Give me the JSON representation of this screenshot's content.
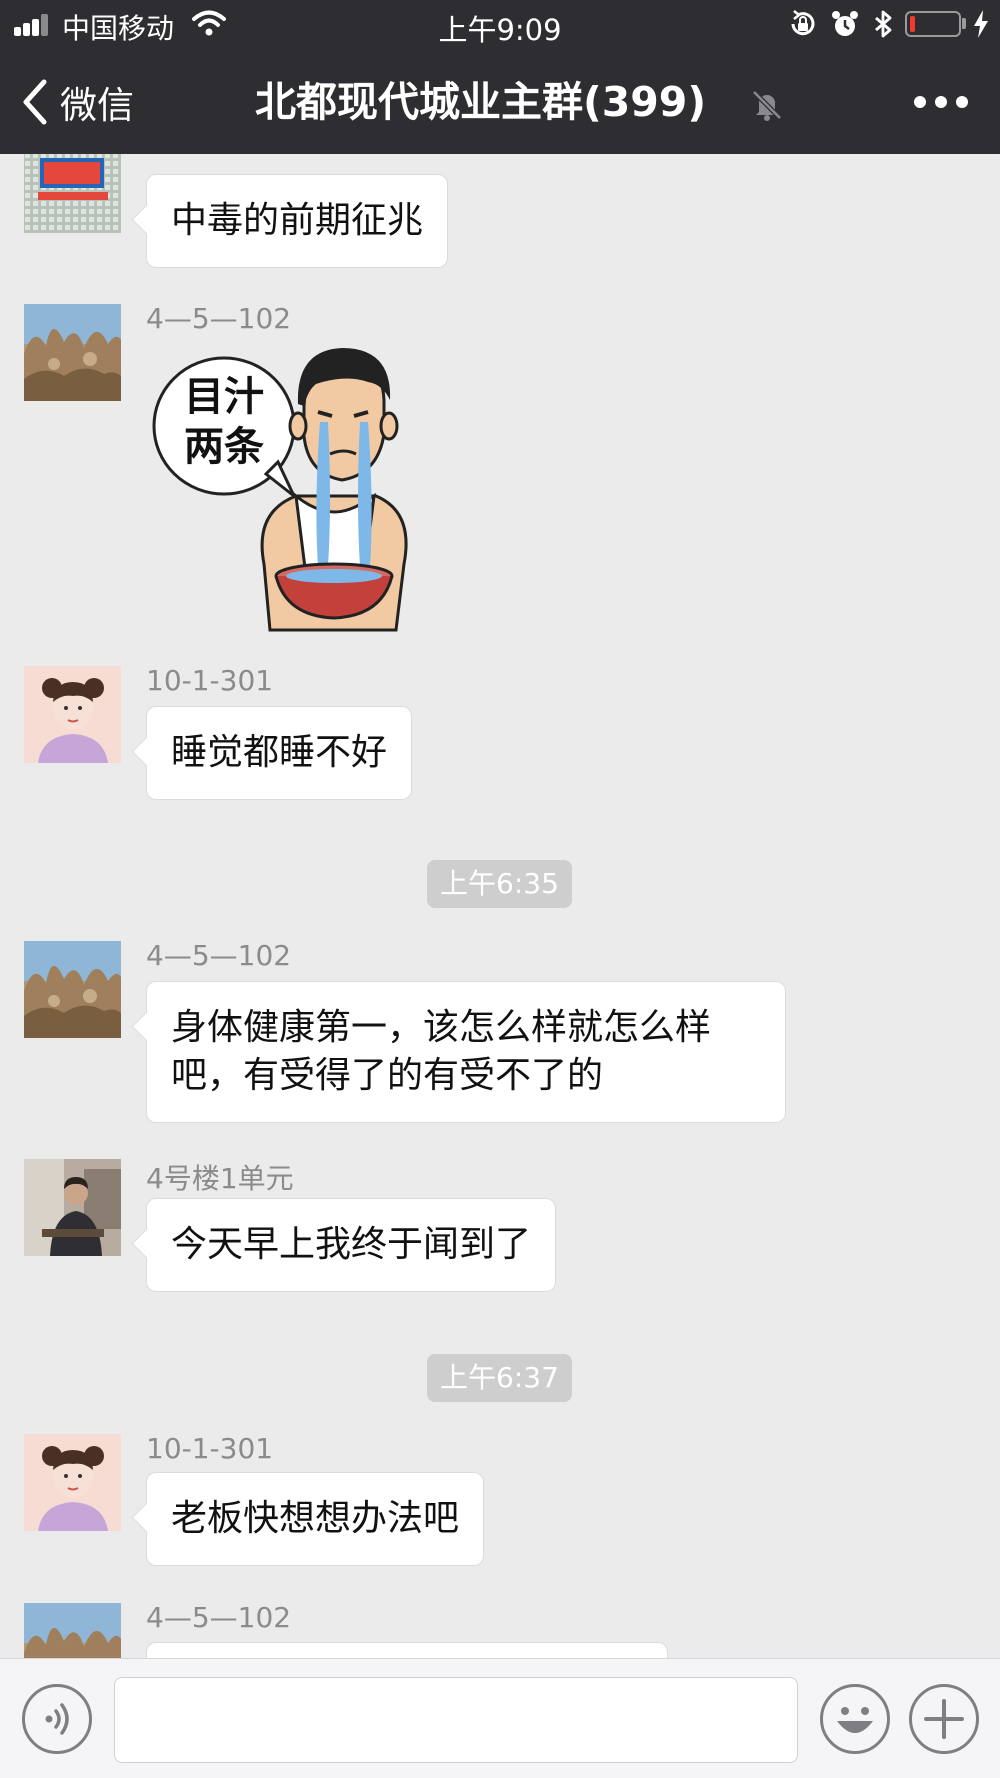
{
  "status_bar": {
    "carrier": "中国移动",
    "time": "上午9:09",
    "icons": [
      "signal-icon",
      "wifi-icon",
      "orientation-lock-icon",
      "alarm-icon",
      "bluetooth-icon",
      "battery-icon",
      "charging-icon"
    ],
    "battery_level": 0.08,
    "battery_color": "#f23b2f"
  },
  "nav": {
    "back_label": "微信",
    "title": "北都现代城业主群(399)",
    "muted": true,
    "more_icon": "more-icon"
  },
  "messages": [
    {
      "type": "text",
      "sender": "",
      "text": "中毒的前期征兆",
      "avatar": "avatar-building"
    },
    {
      "type": "sticker",
      "sender": "4—5—102",
      "sticker_text": "目汁两条",
      "sticker_line1": "目汁",
      "sticker_line2": "两条",
      "avatar": "avatar-rocks"
    },
    {
      "type": "text",
      "sender": "10-1-301",
      "text": "睡觉都睡不好",
      "avatar": "avatar-girl"
    },
    {
      "type": "time",
      "text": "上午6:35"
    },
    {
      "type": "text",
      "sender": "4—5—102",
      "text": "身体健康第一，该怎么样就怎么样吧，有受得了的有受不了的",
      "avatar": "avatar-rocks"
    },
    {
      "type": "text",
      "sender": "4号楼1单元",
      "text": "今天早上我终于闻到了",
      "avatar": "avatar-man"
    },
    {
      "type": "time",
      "text": "上午6:37"
    },
    {
      "type": "text",
      "sender": "10-1-301",
      "text": "老板快想想办法吧",
      "avatar": "avatar-girl"
    },
    {
      "type": "text",
      "sender": "4—5—102",
      "text": "",
      "avatar": "avatar-rocks"
    }
  ],
  "input_bar": {
    "voice_icon": "voice-icon",
    "placeholder": "",
    "emoji_icon": "emoji-icon",
    "add_icon": "add-icon"
  },
  "colors": {
    "header_bg": "#2e2e32",
    "chat_bg": "#ebebeb",
    "bubble_bg": "#ffffff",
    "time_pill_bg": "#cecece"
  }
}
